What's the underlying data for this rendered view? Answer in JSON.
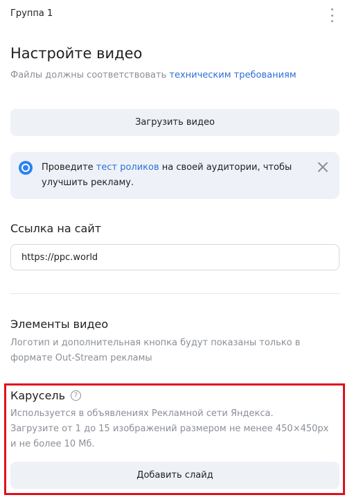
{
  "header": {
    "group_title": "Группа 1",
    "menu_icon": "more-vertical-icon"
  },
  "video_setup": {
    "title": "Настройте видео",
    "subtitle_text": "Файлы должны соответствовать ",
    "subtitle_link": "техническим требованиям",
    "upload_button": "Загрузить видео"
  },
  "notice": {
    "icon": "info-circle-icon",
    "text_before": "Проведите ",
    "link": "тест роликов",
    "text_after": " на своей аудитории, чтобы улучшить рекламу.",
    "close_icon": "close-icon"
  },
  "site_link": {
    "title": "Ссылка на сайт",
    "value": "https://ppc.world"
  },
  "video_elements": {
    "title": "Элементы видео",
    "description": "Логотип и дополнительная кнопка будут показаны только в формате Out-Stream рекламы"
  },
  "carousel": {
    "title": "Карусель",
    "help_icon": "question-circle-icon",
    "help_glyph": "?",
    "description_line1": "Используется в объявлениях Рекламной сети Яндекса.",
    "description_line2": "Загрузите от 1 до 15 изображений размером не менее 450×450px",
    "description_line3": "и не более 10 Мб.",
    "add_button": "Добавить слайд",
    "highlight_color": "#e0101b"
  },
  "colors": {
    "link": "#2f6fd6",
    "muted_text": "#8a8f96",
    "button_bg": "#eef1f5",
    "notice_bg": "#eef2f8",
    "info_icon": "#2a83f0"
  }
}
